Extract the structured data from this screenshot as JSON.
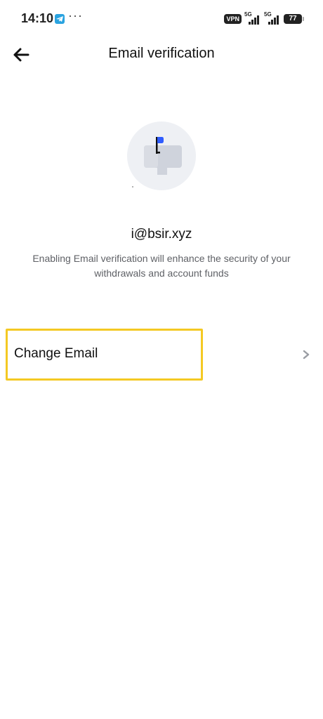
{
  "status_bar": {
    "time": "14:10",
    "more": "···",
    "vpn": "VPN",
    "network_1": "5G",
    "network_2": "5G",
    "battery": "77",
    "icons": [
      "telegram-icon",
      "signal-icon",
      "battery-icon"
    ]
  },
  "header": {
    "title": "Email verification",
    "back_icon": "arrow-left-icon"
  },
  "verification": {
    "illustration": "mailbox-icon",
    "email": "i@bsir.xyz",
    "description": "Enabling Email verification will enhance the security of your withdrawals and account funds"
  },
  "actions": {
    "change_email_label": "Change Email",
    "chevron_icon": "chevron-right-icon"
  },
  "colors": {
    "highlight": "#f4c923",
    "flag_blue": "#2f5cff",
    "icon_bg": "#eef0f4",
    "mailbox_gray": "#cfd3dc",
    "text_secondary": "#5f6166"
  }
}
